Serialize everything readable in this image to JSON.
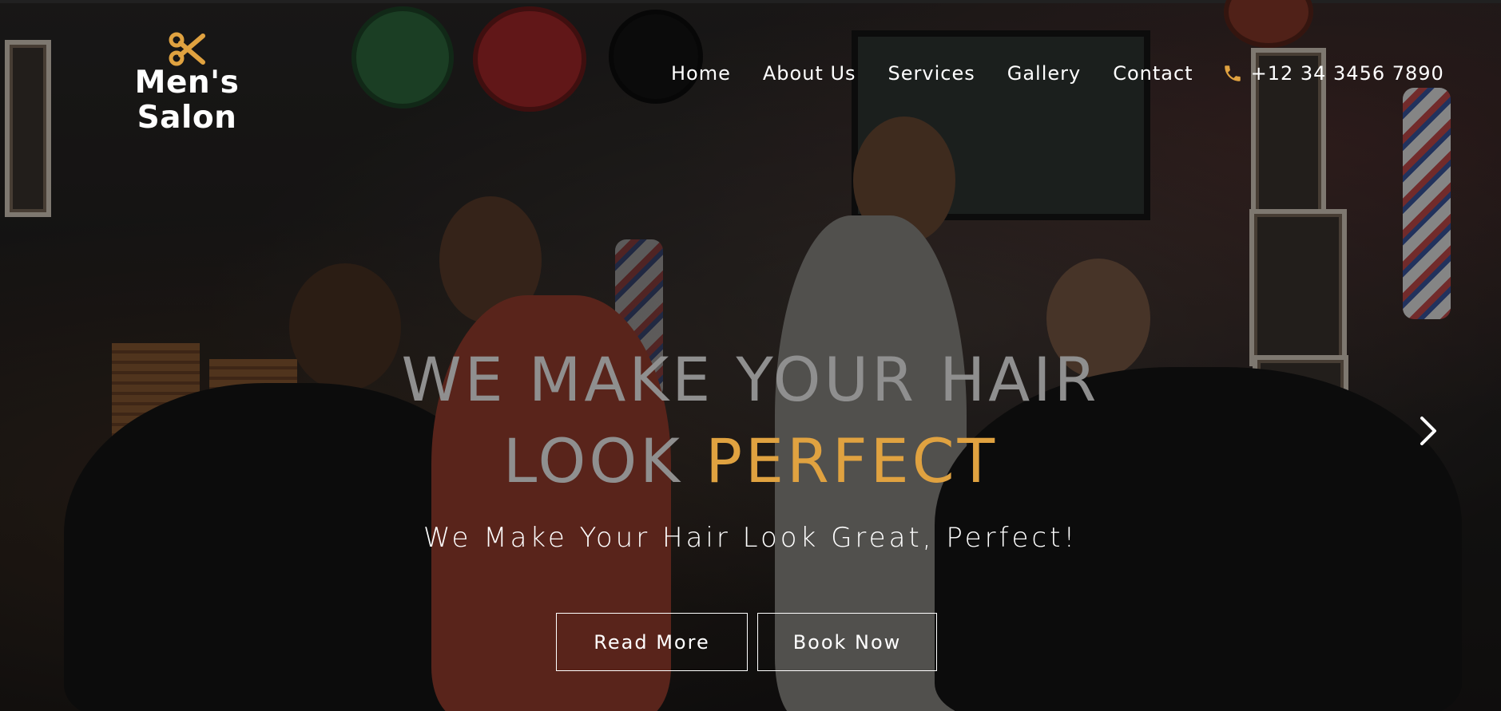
{
  "brand": {
    "name": "Men's Salon",
    "icon": "scissors-icon",
    "accent_color": "#e0a240"
  },
  "nav": {
    "items": [
      {
        "label": "Home"
      },
      {
        "label": "About Us"
      },
      {
        "label": "Services"
      },
      {
        "label": "Gallery"
      },
      {
        "label": "Contact"
      }
    ],
    "phone": {
      "icon": "phone-icon",
      "number": "+12 34 3456 7890"
    }
  },
  "hero": {
    "headline_part1": "WE MAKE YOUR HAIR",
    "headline_part2": "LOOK",
    "headline_accent": "PERFECT",
    "subheadline": "We Make Your Hair Look Great, Perfect!",
    "buttons": {
      "read_more": "Read More",
      "book_now": "Book Now"
    },
    "carousel_next_icon": "chevron-right-icon"
  }
}
